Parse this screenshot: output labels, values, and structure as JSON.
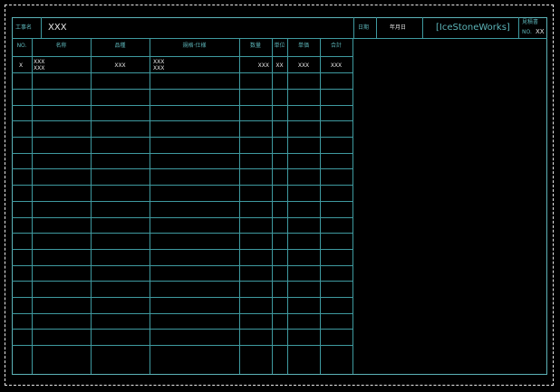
{
  "header": {
    "project_label": "工事名",
    "project_value": "XXX",
    "date_label": "日期",
    "date_value": "年月日",
    "brand": "[IceStoneWorks]",
    "doc_type": "見積書",
    "no_label": "NO.",
    "no_value": "XX"
  },
  "table": {
    "columns": [
      "NO.",
      "名称",
      "品種",
      "規格·仕様",
      "数量",
      "単位",
      "単価",
      "合計"
    ],
    "rows": [
      {
        "no": "X",
        "name": [
          "XXX",
          "XXX"
        ],
        "type": "XXX",
        "spec": [
          "XXX",
          "XXX"
        ],
        "qty": "XXX",
        "unit": "XX",
        "price": "XXX",
        "total": "XXX"
      }
    ]
  },
  "colors": {
    "frame": "#5cb4b8",
    "grid": "#3f9aa0",
    "text": "#e6e6e6",
    "background": "#000000"
  }
}
